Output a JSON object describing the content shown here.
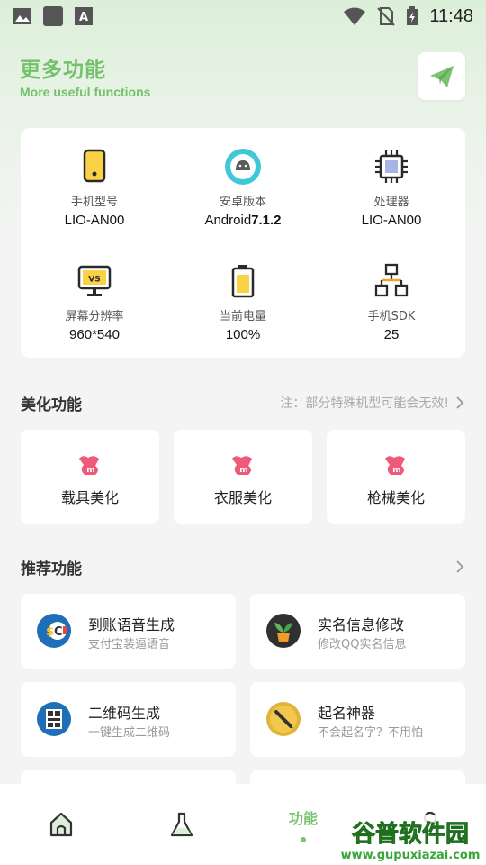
{
  "status_bar": {
    "time": "11:48"
  },
  "header": {
    "title": "更多功能",
    "subtitle": "More useful functions"
  },
  "device_info": [
    {
      "label": "手机型号",
      "value": "LIO-AN00",
      "icon": "phone-icon"
    },
    {
      "label": "安卓版本",
      "value_prefix": "Android",
      "value_bold": "7.1.2",
      "icon": "android-icon"
    },
    {
      "label": "处理器",
      "value": "LIO-AN00",
      "icon": "cpu-icon"
    },
    {
      "label": "屏幕分辨率",
      "value": "960*540",
      "icon": "monitor-icon"
    },
    {
      "label": "当前电量",
      "value": "100%",
      "icon": "battery-icon"
    },
    {
      "label": "手机SDK",
      "value": "25",
      "icon": "sdk-network-icon"
    }
  ],
  "beautify": {
    "title": "美化功能",
    "note": "注：部分特殊机型可能会无效!",
    "items": [
      {
        "label": "载具美化"
      },
      {
        "label": "衣服美化"
      },
      {
        "label": "枪械美化"
      }
    ]
  },
  "recommend": {
    "title": "推荐功能",
    "items": [
      {
        "title": "到账语音生成",
        "subtitle": "支付宝装逼语音",
        "icon": "money-voice-icon"
      },
      {
        "title": "实名信息修改",
        "subtitle": "修改QQ实名信息",
        "icon": "plant-pot-icon"
      },
      {
        "title": "二维码生成",
        "subtitle": "一键生成二维码",
        "icon": "qrcode-icon"
      },
      {
        "title": "起名神器",
        "subtitle": "不会起名字？不用怕",
        "icon": "pen-icon"
      }
    ]
  },
  "bottom_nav": {
    "active_label": "功能"
  },
  "watermark": {
    "brand": "谷普软件园",
    "url": "www.gupuxiazai.com"
  },
  "colors": {
    "accent": "#74c16c",
    "background": "#f3f4f3"
  }
}
